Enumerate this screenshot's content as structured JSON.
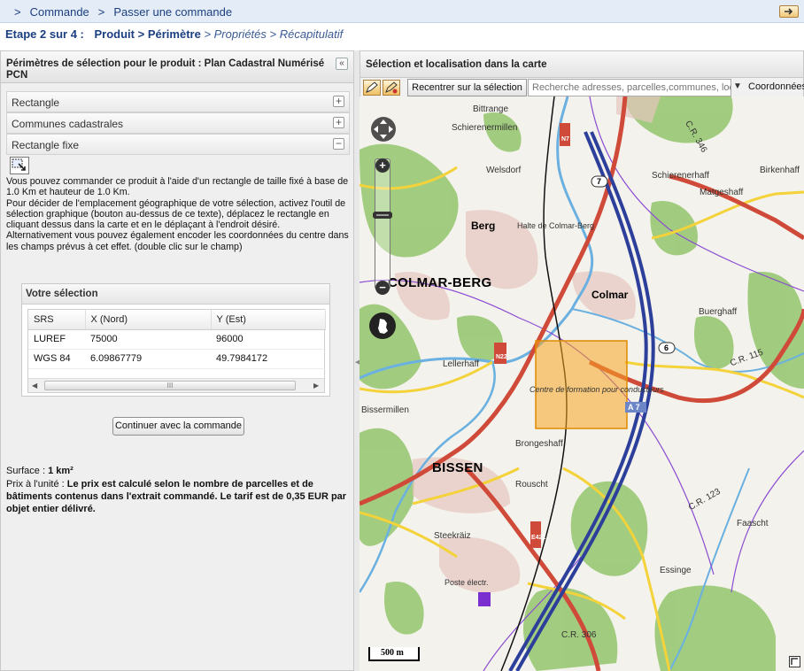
{
  "breadcrumb": {
    "items": [
      "Commande",
      "Passer une commande"
    ],
    "sep": ">"
  },
  "steps": {
    "label": "Etape 2 sur 4 :",
    "items": [
      {
        "label": "Produit",
        "state": "done"
      },
      {
        "label": "> Périmètre",
        "state": "current"
      },
      {
        "label": "> Propriétés",
        "state": "next"
      },
      {
        "label": "> Récapitulatif",
        "state": "next"
      }
    ]
  },
  "left_panel": {
    "title": "Périmètres de sélection pour le produit : Plan Cadastral Numérisé PCN",
    "collapse_label": "«",
    "accordions": [
      {
        "label": "Rectangle",
        "toggle": "+"
      },
      {
        "label": "Communes cadastrales",
        "toggle": "+"
      },
      {
        "label": "Rectangle fixe",
        "toggle": "−"
      }
    ],
    "description": "Vous pouvez commander ce produit à l'aide d'un rectangle de taille fixé à base de 1.0 Km et hauteur de 1.0 Km.\nPour décider de l'emplacement géographique de votre sélection, activez l'outil de sélection graphique (bouton au-dessus de ce texte), déplacez le rectangle en cliquant dessus dans la carte et en le déplaçant à l'endroit désiré.\nAlternativement vous pouvez également encoder les coordonnées du centre dans les champs prévus à cet effet. (double clic sur le champ)",
    "selection": {
      "title": "Votre sélection",
      "columns": [
        "SRS",
        "X (Nord)",
        "Y (Est)"
      ],
      "rows": [
        [
          "LUREF",
          "75000",
          "96000"
        ],
        [
          "WGS 84",
          "6.09867779",
          "49.7984172"
        ]
      ],
      "scroll_thumb": "III"
    },
    "continue_label": "Continuer avec la commande",
    "surface_label": "Surface :",
    "surface_value": "1 km²",
    "price_label": "Prix à l'unité :",
    "price_value": "Le prix est calculé selon le nombre de parcelles et de bâtiments contenus dans l'extrait commandé. Le tarif est de 0,35 EUR par objet entier délivré."
  },
  "right_panel": {
    "title": "Sélection et localisation dans la carte",
    "recenter_label": "Recentrer sur la sélection",
    "search_placeholder": "Recherche adresses, parcelles,communes, loc",
    "coords_label": "Coordonnées"
  },
  "map": {
    "scale_label": "500 m",
    "places": [
      {
        "name": "COLMAR-BERG",
        "size": "big"
      },
      {
        "name": "BISSEN",
        "size": "big"
      },
      {
        "name": "Berg",
        "size": "mid"
      },
      {
        "name": "Colmar",
        "size": "mid"
      },
      {
        "name": "Welsdorf",
        "size": "sm"
      },
      {
        "name": "Lellerhaff",
        "size": "sm"
      },
      {
        "name": "Bissermillen",
        "size": "sm"
      },
      {
        "name": "Brongeshaff",
        "size": "sm"
      },
      {
        "name": "Rouscht",
        "size": "sm"
      },
      {
        "name": "Steekräiz",
        "size": "sm"
      },
      {
        "name": "Schierenerhaff",
        "size": "sm"
      },
      {
        "name": "Matgeshaff",
        "size": "sm"
      },
      {
        "name": "Birkenhaff",
        "size": "sm"
      },
      {
        "name": "Buerghaff",
        "size": "sm"
      },
      {
        "name": "Faascht",
        "size": "sm"
      },
      {
        "name": "Essinge",
        "size": "sm"
      },
      {
        "name": "Bittrange",
        "size": "sm"
      },
      {
        "name": "Schierenermillen",
        "size": "sm"
      },
      {
        "name": "Centre de formation pour conducteurs",
        "size": "sm"
      },
      {
        "name": "Halte de Colmar-Berg",
        "size": "sm"
      },
      {
        "name": "Poste électr.",
        "size": "sm"
      }
    ],
    "roads": [
      "C.R. 346",
      "C.R. 115",
      "C.R. 123",
      "C.R. 306",
      "A 7",
      "N 7",
      "E 421",
      "N 22",
      "6",
      "7"
    ],
    "colors": {
      "selection": "#f5a623",
      "motorway": "#2c3f9a",
      "road": "#d04a3a",
      "forest": "#9dca7a",
      "water": "#6ab0e0"
    }
  }
}
